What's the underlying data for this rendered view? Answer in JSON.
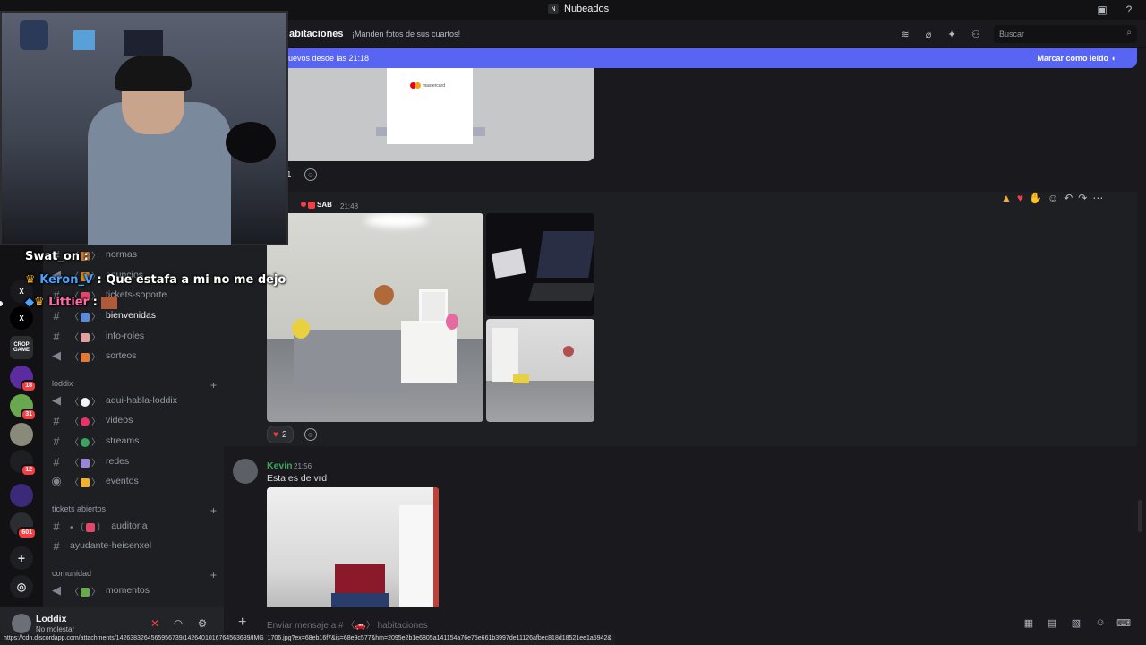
{
  "titlebar": {
    "app_name": "Nubeados"
  },
  "header": {
    "channel": "abitaciones",
    "topic": "¡Manden fotos de sus cuartos!",
    "search_placeholder": "Buscar"
  },
  "new_messages_bar": {
    "left_text": "uevos desde las 21:18",
    "right_text": "Marcar como leído"
  },
  "servers": [
    {
      "label": "X",
      "badge": ""
    },
    {
      "label": "X",
      "badge": ""
    },
    {
      "label": "CROP GAME",
      "badge": ""
    },
    {
      "label": "",
      "badge": "18"
    },
    {
      "label": "",
      "badge": "31"
    },
    {
      "label": "",
      "badge": ""
    },
    {
      "label": "",
      "badge": "12"
    },
    {
      "label": "",
      "badge": ""
    },
    {
      "label": "",
      "badge": "601"
    }
  ],
  "channels": {
    "top": [
      {
        "name": "normas",
        "icon": "hash"
      },
      {
        "name": "anuncios",
        "icon": "megaphone"
      },
      {
        "name": "tickets-soporte",
        "icon": "hash"
      },
      {
        "name": "bienvenidas",
        "icon": "hash"
      },
      {
        "name": "info-roles",
        "icon": "hash"
      },
      {
        "name": "sorteos",
        "icon": "megaphone"
      }
    ],
    "cat_loddix": "loddix",
    "loddix": [
      {
        "name": "aqui-habla-loddix",
        "icon": "megaphone"
      },
      {
        "name": "videos",
        "icon": "hash"
      },
      {
        "name": "streams",
        "icon": "hash"
      },
      {
        "name": "redes",
        "icon": "hash"
      },
      {
        "name": "eventos",
        "icon": "stage"
      }
    ],
    "cat_tickets": "tickets abiertos",
    "tickets": [
      {
        "name": "auditoria",
        "icon": "hash"
      },
      {
        "name": "ayudante-heisenxel",
        "icon": "hash"
      }
    ],
    "cat_comunidad": "comunidad",
    "comunidad": [
      {
        "name": "momentos",
        "icon": "megaphone"
      }
    ]
  },
  "user": {
    "name": "Loddix",
    "status": "No molestar"
  },
  "messages": {
    "first_reaction_count": "1",
    "sab_tag": "SAB",
    "sab_time": "21:48",
    "heart_reaction_count": "2",
    "kevin_name": "Kevin",
    "kevin_time": "21:56",
    "kevin_text": "Esta es de vrd"
  },
  "receipt_brand": "mastercard",
  "composer": {
    "placeholder": "Enviar mensaje a # 〈🚗〉 habitaciones"
  },
  "status_url": "https://cdn.discordapp.com/attachments/1426383264565956739/1426401016764563639/IMG_1706.jpg?ex=68eb16f7&is=68e9c577&hm=2095e2b1e6805a141154a76e75e661b3997de11126afbec818d18521ee1a5942&",
  "overlay_chat": [
    {
      "user": "Swat_on",
      "text": "",
      "color": "#ffffff"
    },
    {
      "user": "Keron_V",
      "text": "Que estafa a mi no me dejo",
      "color": "#4aa3ff"
    },
    {
      "user": "Littier",
      "text": "",
      "color": "#ff6fa6"
    }
  ],
  "colors": {
    "accent": "#5865f2",
    "online_green": "#3ba55c",
    "danger": "#f23f43"
  }
}
